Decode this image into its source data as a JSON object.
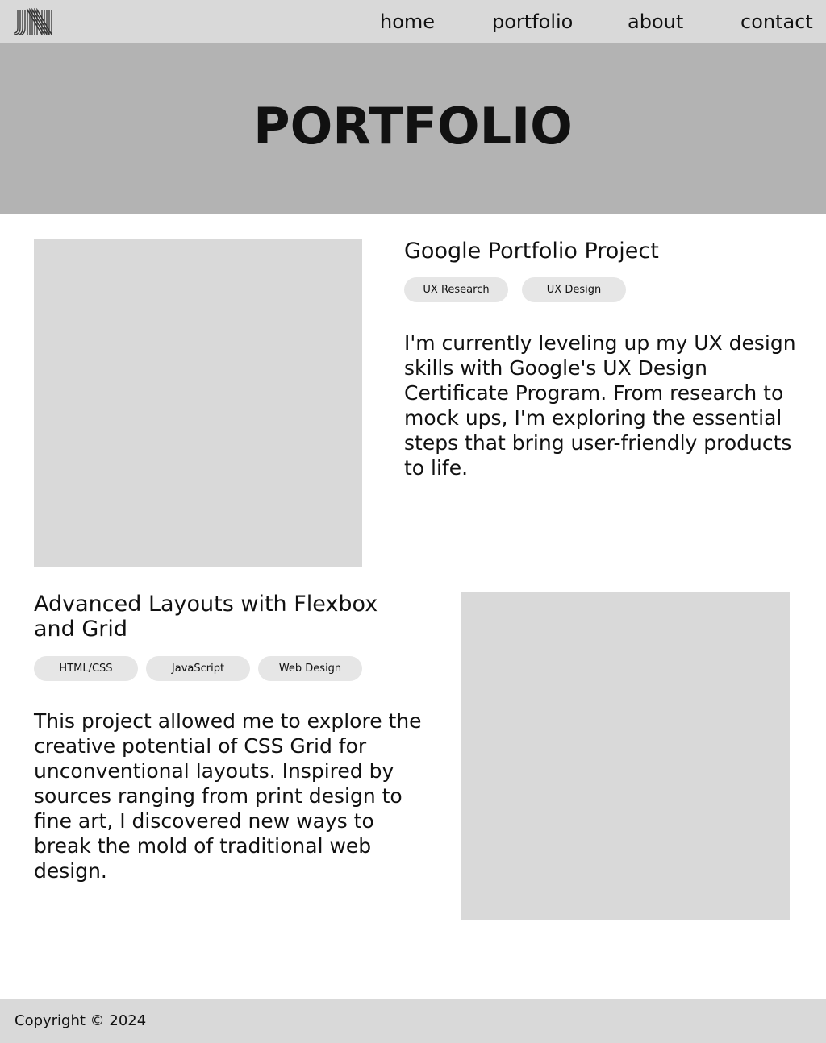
{
  "header": {
    "logo_text": "JN",
    "nav": {
      "home": "home",
      "portfolio": "portfolio",
      "about": "about",
      "contact": "contact"
    }
  },
  "hero": {
    "title": "PORTFOLIO"
  },
  "projects": [
    {
      "title": "Google Portfolio Project",
      "tags": [
        "UX Research",
        "UX Design"
      ],
      "description": "I'm currently leveling up my UX design skills with Google's UX Design Certificate Program.  From research to mock ups, I'm exploring the essential steps that bring user-friendly products to life."
    },
    {
      "title": "Advanced Layouts with Flexbox and Grid",
      "tags": [
        "HTML/CSS",
        "JavaScript",
        "Web Design"
      ],
      "description": "This project allowed me to explore the creative potential of CSS Grid for unconventional layouts. Inspired by sources ranging from print design to fine art, I discovered new ways to break the mold of traditional web design."
    }
  ],
  "footer": {
    "copyright": "Copyright © 2024"
  },
  "colors": {
    "nav_bg": "#d9d9d9",
    "hero_bg": "#b3b3b3",
    "placeholder": "#d9d9d9",
    "tag_bg": "#e6e6e6",
    "text": "#111111"
  }
}
